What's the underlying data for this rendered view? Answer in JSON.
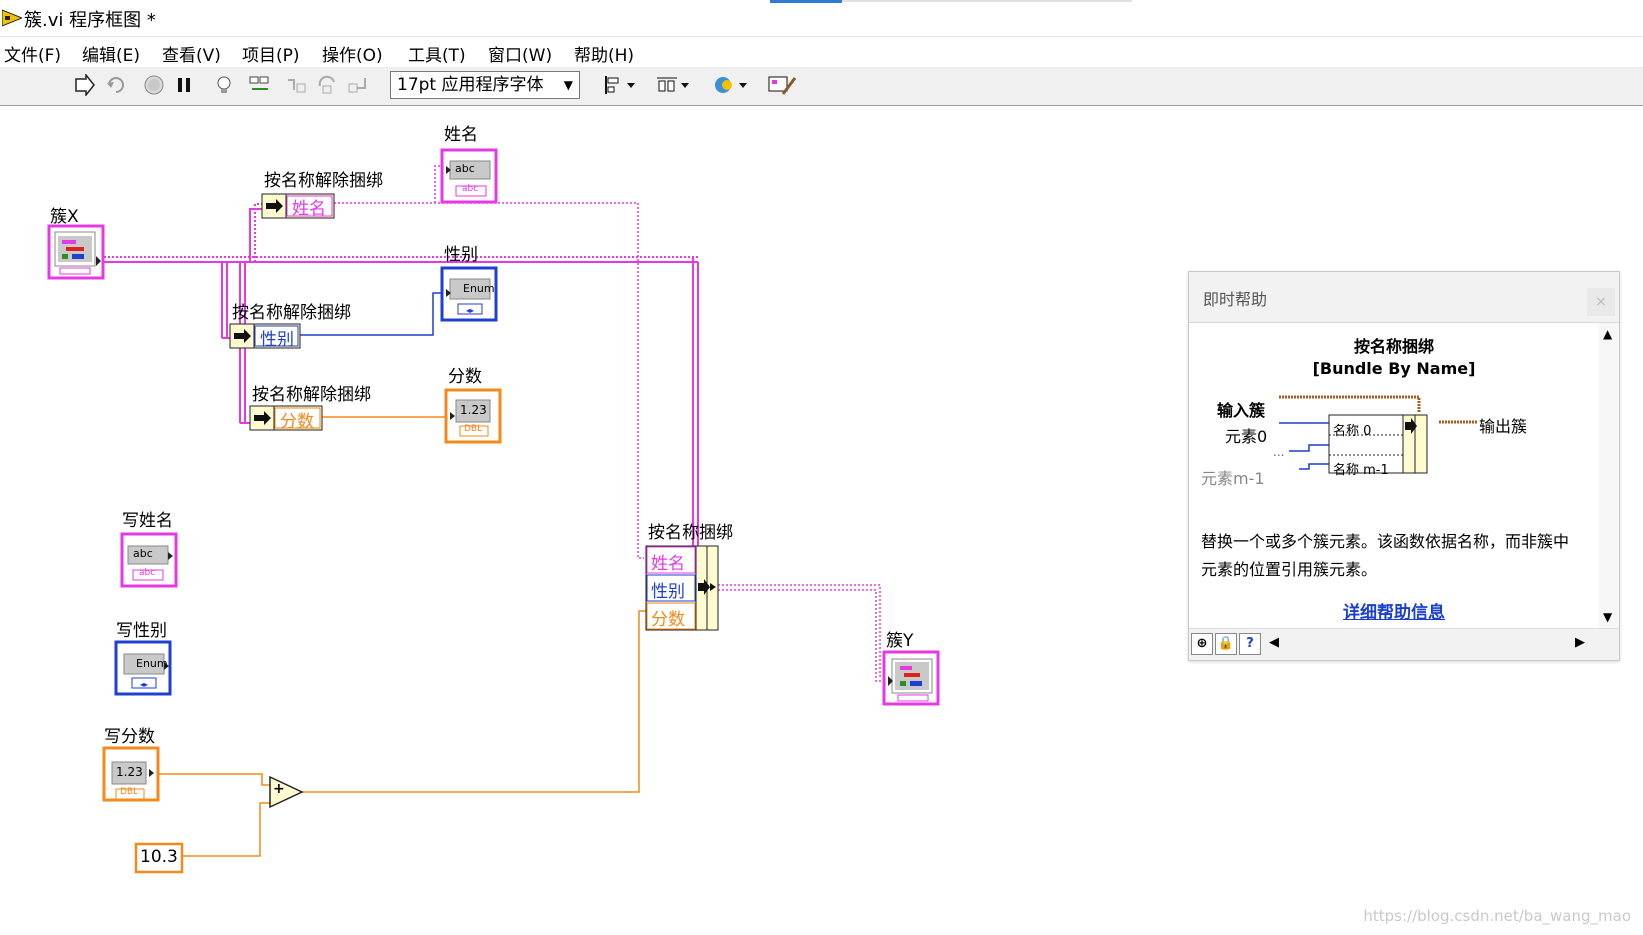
{
  "window": {
    "title": "簇.vi 程序框图 *"
  },
  "menu": [
    "文件(F)",
    "编辑(E)",
    "查看(V)",
    "项目(P)",
    "操作(O)",
    "工具(T)",
    "窗口(W)",
    "帮助(H)"
  ],
  "toolbar": {
    "font_selector": "17pt 应用程序字体",
    "icons": [
      "run-arrow-icon",
      "run-continuous-icon",
      "abort-icon",
      "pause-icon",
      "highlight-execution-icon",
      "retain-wire-values-icon",
      "step-into-icon",
      "step-over-icon",
      "step-out-icon",
      "align-objects-icon",
      "distribute-objects-icon",
      "reorder-icon",
      "clean-up-diagram-icon"
    ]
  },
  "diagram": {
    "cluster_x_label": "簇X",
    "unbundle1_title": "按名称解除捆绑",
    "unbundle1_elem": "姓名",
    "unbundle2_title": "按名称解除捆绑",
    "unbundle2_elem": "性别",
    "unbundle3_title": "按名称解除捆绑",
    "unbundle3_elem": "分数",
    "name_indicator_label": "姓名",
    "name_indicator_text": "abc",
    "sex_indicator_label": "性别",
    "sex_indicator_text": "Enum",
    "score_indicator_label": "分数",
    "score_indicator_text": "1.23",
    "write_name_label": "写姓名",
    "write_name_text": "abc",
    "write_sex_label": "写性别",
    "write_sex_text": "Enum",
    "write_score_label": "写分数",
    "write_score_text": "1.23",
    "bundle_title": "按名称捆绑",
    "bundle_elems": [
      "姓名",
      "性别",
      "分数"
    ],
    "cluster_y_label": "簇Y",
    "constant_value": "10.3",
    "add_symbol": "+",
    "type_dbl": "DBL",
    "type_str": "abc"
  },
  "help": {
    "title": "即时帮助",
    "close": "×",
    "func_name": "按名称捆绑",
    "func_name_en": "[Bundle By Name]",
    "input_cluster": "输入簇",
    "element0": "元素0",
    "ellipsis": "...",
    "element_m1": "元素m-1",
    "output_cluster": "输出簇",
    "name0": "名称 0",
    "name_m1": "名称 m-1",
    "description": "替换一个或多个簇元素。该函数依据名称，而非簇中元素的位置引用簇元素。",
    "link": "详细帮助信息",
    "footer_help_btn": "?"
  },
  "watermark": "https://blog.csdn.net/ba_wang_mao",
  "colors": {
    "cluster": "#e639e6",
    "string": "#e639e6",
    "enum": "#1f3fd0",
    "dbl": "#f28a1c",
    "node_bg": "#fffbd1"
  }
}
